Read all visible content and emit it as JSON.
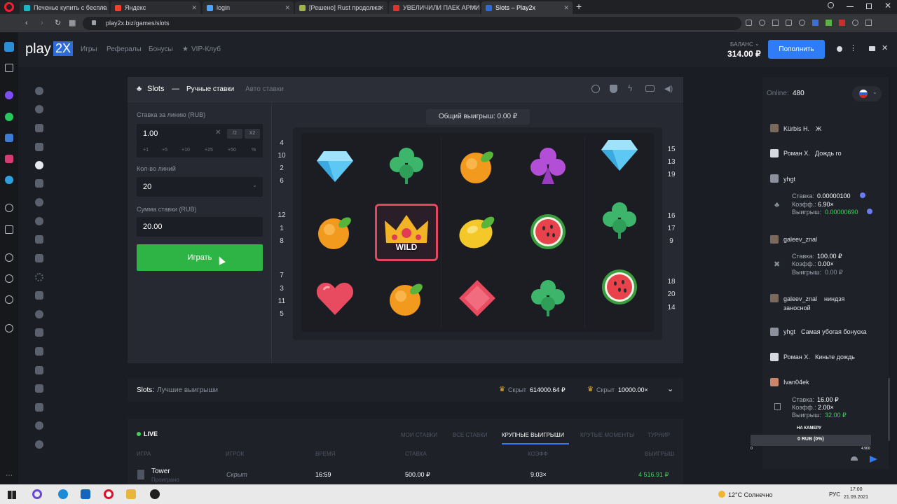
{
  "browser": {
    "tabs": [
      {
        "title": "Печенье купить с беспла",
        "fav": "#1ab8c2"
      },
      {
        "title": "Яндекс",
        "fav": "#f2402f"
      },
      {
        "title": "login",
        "fav": "#4aa3ff"
      },
      {
        "title": "[Решено] Rust продолжа",
        "fav": "#9fb34a"
      },
      {
        "title": "УВЕЛИЧИЛИ ПАЕК АРМИ",
        "fav": "#e33030"
      },
      {
        "title": "Slots – Play2x",
        "fav": "#2d6bdc"
      }
    ],
    "address": "play2x.biz/games/slots",
    "new_tab": "+"
  },
  "site": {
    "logo": "play",
    "logo_badge": "2X",
    "nav": [
      "Игры",
      "Рефералы",
      "Бонусы",
      "VIP-Клуб"
    ],
    "balance_label": "БАЛАНС",
    "balance": "314.00 ₽",
    "topup": "Пополнить"
  },
  "game": {
    "title": "Slots",
    "dash": "—",
    "mode_active": "Ручные ставки",
    "mode_other": "Авто ставки",
    "bet_label": "Ставка за линию (RUB)",
    "bet_value": "1.00",
    "half": "/2",
    "double": "X2",
    "quick": [
      "+1",
      "+5",
      "+10",
      "+25",
      "+50",
      "%"
    ],
    "lines_label": "Кол-во линий",
    "lines_value": "20",
    "sum_label": "Сумма ставки (RUB)",
    "sum_value": "20.00",
    "play": "Играть",
    "total_win": "Общий выигрыш: 0.00 ₽",
    "lines_left": [
      "4",
      "10",
      "2",
      "6",
      "12",
      "1",
      "8",
      "7",
      "3",
      "11",
      "5"
    ],
    "lines_right": [
      "15",
      "13",
      "19",
      "16",
      "17",
      "9",
      "18",
      "20",
      "14"
    ],
    "wild_text": "WILD",
    "grid": [
      [
        "diamond",
        "clover",
        "orange",
        "club",
        "diamond"
      ],
      [
        "orange",
        "wild",
        "lemon",
        "watermelon",
        "clover"
      ],
      [
        "heart",
        "orange",
        "rhombus",
        "clover",
        "watermelon"
      ]
    ]
  },
  "best": {
    "title": "Slots:",
    "subtitle": "Лучшие выигрыши",
    "w1_label": "Скрыт",
    "w1_value": "614000.64 ₽",
    "w2_label": "Скрыт",
    "w2_value": "10000.00×"
  },
  "live": {
    "badge": "LIVE",
    "tabs": [
      "МОИ СТАВКИ",
      "ВСЕ СТАВКИ",
      "КРУПНЫЕ ВЫИГРЫШИ",
      "КРУТЫЕ МОМЕНТЫ",
      "ТУРНИР"
    ],
    "headers": [
      "ИГРА",
      "ИГРОК",
      "ВРЕМЯ",
      "СТАВКА",
      "КОЭФФ",
      "ВЫИГРЫШ"
    ],
    "row": {
      "game": "Tower",
      "sub": "Проиграно",
      "player": "Скрыт",
      "time": "16:59",
      "bet": "500.00 ₽",
      "coef": "9.03×",
      "win": "4 516.91 ₽"
    }
  },
  "chat": {
    "online_label": "Online:",
    "online": "480",
    "msgs": [
      {
        "name": "Kürbis H.",
        "text": "Ж"
      },
      {
        "name": "Роман Х.",
        "text": "Дождь го"
      },
      {
        "name": "yhgt",
        "text": ""
      },
      {
        "name": "galeev_znal",
        "text": ""
      },
      {
        "name": "galeev_znal",
        "text": "ниндзя"
      },
      {
        "name": "",
        "text": "заносной"
      },
      {
        "name": "yhgt",
        "text": "Самая убогая бонуска"
      },
      {
        "name": "Роман Х.",
        "text": "Киньте дождь"
      },
      {
        "name": "Ivan04ek",
        "text": ""
      }
    ],
    "bet1": {
      "stake_l": "Ставка:",
      "stake": "0.00000100",
      "coef_l": "Коэфф.:",
      "coef": "6.90×",
      "win_l": "Выигрыш:",
      "win": "0.00000690"
    },
    "bet2": {
      "stake_l": "Ставка:",
      "stake": "100.00 ₽",
      "coef_l": "Коэфф.:",
      "coef": "0.00×",
      "win_l": "Выигрыш:",
      "win": "0.00 ₽"
    },
    "bet3": {
      "stake_l": "Ставка:",
      "stake": "16.00 ₽",
      "coef_l": "Коэфф.:",
      "coef": "2.00×",
      "win_l": "Выигрыш:",
      "win": "32.00 ₽"
    },
    "camera": "НА КАМЕРУ",
    "progress": "0 RUB (0%)",
    "prog_left": "0",
    "prog_right": "4.900"
  },
  "taskbar": {
    "weather": "12°C Солнечно",
    "lang": "РУС",
    "time": "17:00",
    "date": "21.09.2021"
  },
  "colors": {
    "accent": "#2e7cf6",
    "play": "#2eb444",
    "win": "#3fd25a"
  }
}
